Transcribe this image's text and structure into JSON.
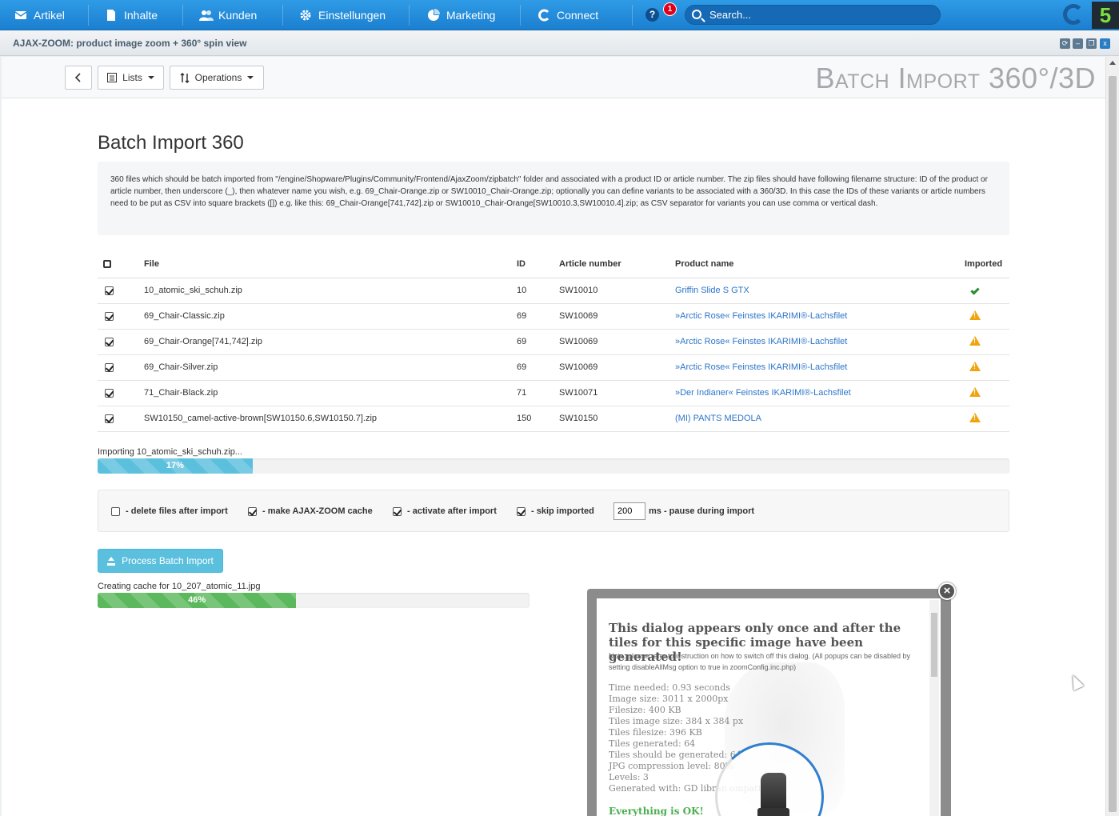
{
  "nav": {
    "items": [
      {
        "label": "Artikel",
        "icon": "mail-icon"
      },
      {
        "label": "Inhalte",
        "icon": "document-icon"
      },
      {
        "label": "Kunden",
        "icon": "users-icon"
      },
      {
        "label": "Einstellungen",
        "icon": "gear-icon"
      },
      {
        "label": "Marketing",
        "icon": "pie-chart-icon"
      },
      {
        "label": "Connect",
        "icon": "connect-icon"
      }
    ],
    "help": "?",
    "notification_count": "1",
    "search_placeholder": "Search...",
    "logo_text": "5"
  },
  "window": {
    "title": "AJAX-ZOOM: product image zoom + 360° spin view",
    "close": "x"
  },
  "toolbar": {
    "back": "<",
    "lists": "Lists",
    "operations": "Operations",
    "big_title": "Batch Import 360°/3D"
  },
  "page": {
    "title": "Batch Import 360",
    "info": "360 files which should be batch imported from \"/engine/Shopware/Plugins/Community/Frontend/AjaxZoom/zipbatch\" folder and associated with a product ID or article number. The zip files should have following filename structure: ID of the product or article number, then underscore (_), then whatever name you wish, e.g. 69_Chair-Orange.zip or SW10010_Chair-Orange.zip; optionally you can define variants to be associated with a 360/3D. In this case the IDs of these variants or article numbers need to be put as CSV into square brackets ([]) e.g. like this: 69_Chair-Orange[741,742].zip or SW10010_Chair-Orange[SW10010.3,SW10010.4].zip; as CSV separator for variants you can use comma or vertical dash."
  },
  "table": {
    "headers": {
      "file": "File",
      "id": "ID",
      "article": "Article number",
      "product": "Product name",
      "imported": "Imported"
    },
    "rows": [
      {
        "file": "10_atomic_ski_schuh.zip",
        "id": "10",
        "article": "SW10010",
        "product": "Griffin Slide S GTX",
        "status": "ok"
      },
      {
        "file": "69_Chair-Classic.zip",
        "id": "69",
        "article": "SW10069",
        "product": "»Arctic Rose« Feinstes IKARIMI®-Lachsfilet",
        "status": "warning"
      },
      {
        "file": "69_Chair-Orange[741,742].zip",
        "id": "69",
        "article": "SW10069",
        "product": "»Arctic Rose« Feinstes IKARIMI®-Lachsfilet",
        "status": "warning"
      },
      {
        "file": "69_Chair-Silver.zip",
        "id": "69",
        "article": "SW10069",
        "product": "»Arctic Rose« Feinstes IKARIMI®-Lachsfilet",
        "status": "warning"
      },
      {
        "file": "71_Chair-Black.zip",
        "id": "71",
        "article": "SW10071",
        "product": "»Der Indianer« Feinstes IKARIMI®-Lachsfilet",
        "status": "warning"
      },
      {
        "file": "SW10150_camel-active-brown[SW10150.6,SW10150.7].zip",
        "id": "150",
        "article": "SW10150",
        "product": "(MI) PANTS MEDOLA",
        "status": "warning"
      }
    ]
  },
  "progress_import": {
    "label": "Importing 10_atomic_ski_schuh.zip...",
    "percent": 17,
    "text": "17%"
  },
  "options": {
    "delete_files": "- delete files after import",
    "make_cache": "- make AJAX-ZOOM cache",
    "activate": "- activate after import",
    "skip_imported": "- skip imported",
    "pause_value": "200",
    "pause_label": "ms - pause during import"
  },
  "process_button": "Process Batch Import",
  "progress_cache": {
    "label": "Creating cache for 10_207_atomic_11.jpg",
    "percent": 46,
    "text": "46%"
  },
  "dialog": {
    "heading": "This dialog appears only once and after the tiles for this specific image have been generated!",
    "note": "Note: please refer to instruction on how to switch off this dialog. (All popups can be disabled by setting disableAllMsg option to true in zoomConfig.inc.php)",
    "stats": [
      "Time needed: 0.93 seconds",
      "Image size: 3011 x 2000px",
      "Filesize: 400 KB",
      "Tiles image size: 384 x 384 px",
      "Tiles filesize: 396 KB",
      "Tiles generated: 64",
      "Tiles should be generated: 64",
      "JPG compression level: 80%",
      "Levels: 3",
      "Generated with: GD libran                         ompatible)"
    ],
    "ok": "Everything is OK!",
    "close": "×"
  },
  "colors": {
    "accent": "#1b7fd0",
    "info": "#5bc0de",
    "success": "#5cb85c",
    "warning": "#f0a30a",
    "link": "#2d75c8"
  }
}
